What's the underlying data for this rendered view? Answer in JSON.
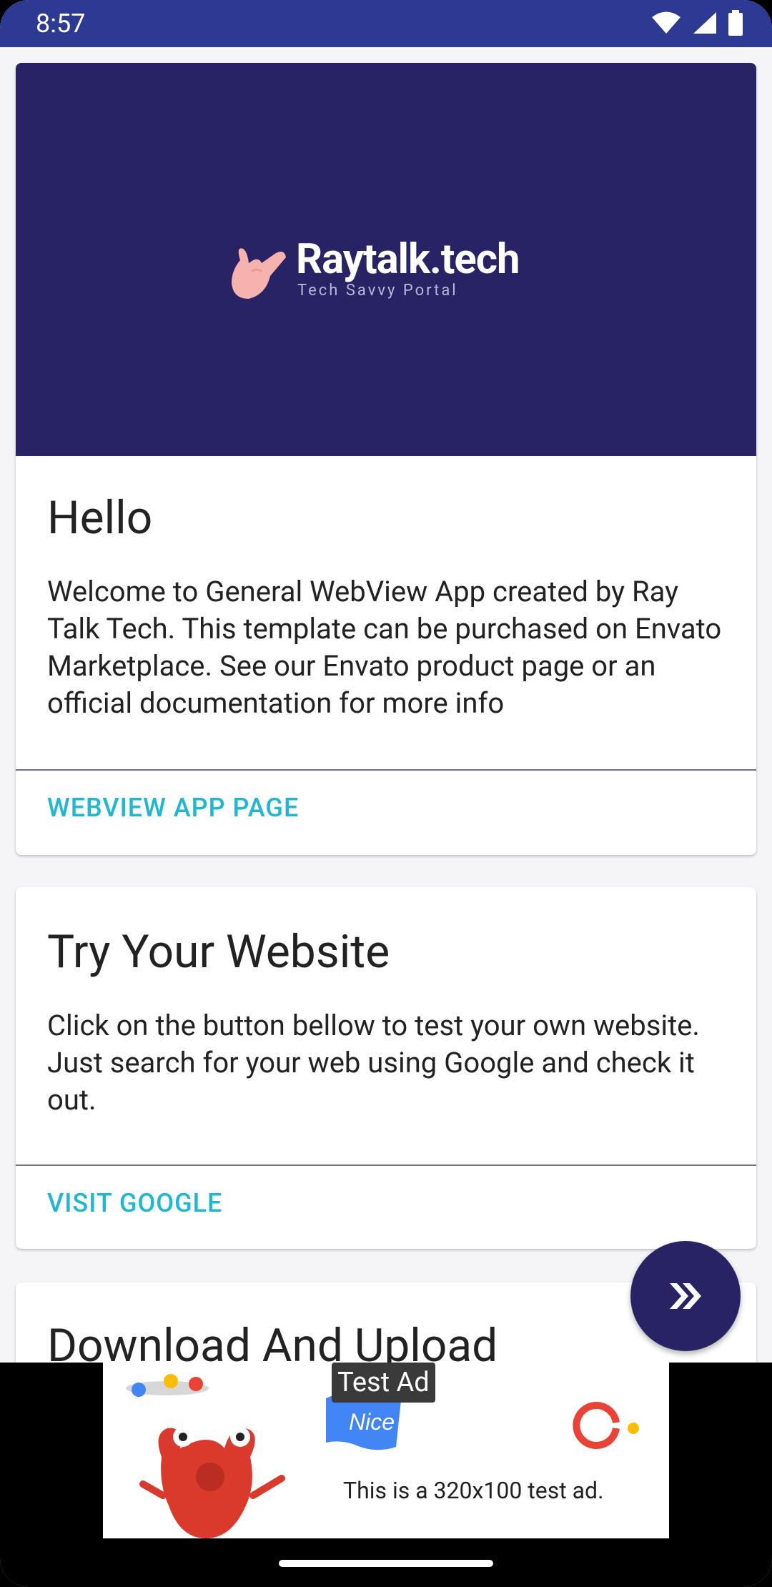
{
  "status_bar": {
    "time": "8:57"
  },
  "banner": {
    "logo_title": "Raytalk.tech",
    "logo_subtitle": "Tech Savvy Portal"
  },
  "cards": [
    {
      "title": "Hello",
      "body": "Welcome to General WebView App created by Ray Talk Tech. This template can be purchased on Envato Marketplace. See our Envato product page or an official documentation for more info",
      "action": "WEBVIEW APP PAGE"
    },
    {
      "title": "Try Your Website",
      "body": "Click on the button bellow to test your own website. Just search for your web using Google and check it out.",
      "action": "VISIT GOOGLE"
    },
    {
      "title": "Download And Upload"
    }
  ],
  "fab": {
    "icon": "double-chevron-right-icon"
  },
  "ad": {
    "label": "Test Ad",
    "headline": "Nice job!",
    "text": "This is a 320x100 test ad."
  },
  "colors": {
    "status_bar": "#2c3a93",
    "banner": "#272364",
    "accent": "#1fb7d2",
    "fab": "#272364"
  }
}
